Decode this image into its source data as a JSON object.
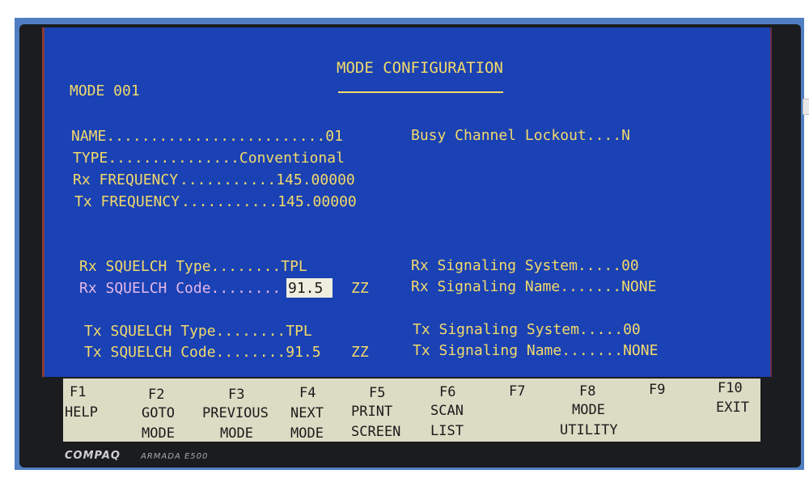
{
  "screen": {
    "title": "MODE CONFIGURATION",
    "mode_label": "MODE 001",
    "fields": {
      "name": "NAME.........................01",
      "type": "TYPE...............Conventional",
      "rx_freq_label": "Rx FREQUENCY",
      "rx_freq_value": "...........145.00000",
      "tx_freq_label": "Tx FREQUENCY",
      "tx_freq_value": "...........145.00000",
      "busy_channel": "Busy Channel Lockout....N",
      "rx_squelch_type": "Rx SQUELCH Type........TPL",
      "rx_squelch_code_label": "Rx SQUELCH Code........",
      "rx_squelch_code_value": "91.5",
      "rx_squelch_code_extra": "ZZ",
      "tx_squelch_type": "Tx SQUELCH Type........TPL",
      "tx_squelch_code": "Tx SQUELCH Code........91.5",
      "tx_squelch_code_extra": "ZZ",
      "rx_sig_system": "Rx Signaling System.....00",
      "rx_sig_name": "Rx Signaling Name.......NONE",
      "tx_sig_system": "Tx Signaling System.....00",
      "tx_sig_name": "Tx Signaling Name.......NONE"
    }
  },
  "function_keys": [
    {
      "key": "F1",
      "line1": "HELP",
      "line2": ""
    },
    {
      "key": "F2",
      "line1": "GOTO",
      "line2": "MODE"
    },
    {
      "key": "F3",
      "line1": "PREVIOUS",
      "line2": "MODE"
    },
    {
      "key": "F4",
      "line1": "NEXT",
      "line2": "MODE"
    },
    {
      "key": "F5",
      "line1": "PRINT",
      "line2": "SCREEN"
    },
    {
      "key": "F6",
      "line1": "SCAN",
      "line2": "LIST"
    },
    {
      "key": "F7",
      "line1": "",
      "line2": ""
    },
    {
      "key": "F8",
      "line1": "MODE",
      "line2": "UTILITY"
    },
    {
      "key": "F9",
      "line1": "",
      "line2": ""
    },
    {
      "key": "F10",
      "line1": "EXIT",
      "line2": ""
    }
  ],
  "hardware": {
    "brand": "COMPAQ",
    "model": "ARMADA E500"
  },
  "colors": {
    "screen_bg": "#1a42b4",
    "text_yellow": "#f3d96b",
    "text_pink": "#e6b8e8",
    "fn_bar_bg": "#dcdbc4"
  }
}
